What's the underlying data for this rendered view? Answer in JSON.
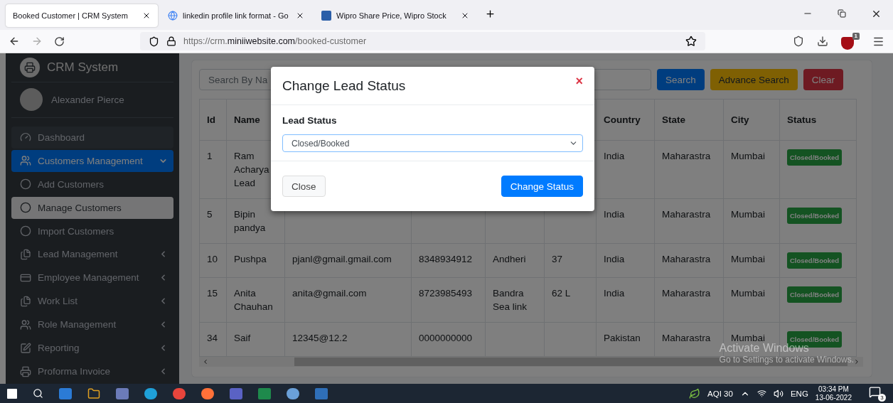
{
  "browser": {
    "tabs": [
      {
        "title": "Booked Customer | CRM System",
        "selected": true,
        "kind": "site"
      },
      {
        "title": "linkedin profile link format - Go",
        "selected": false,
        "kind": "search"
      },
      {
        "title": "Wipro Share Price, Wipro Stock",
        "selected": false,
        "kind": "stock"
      }
    ],
    "url": {
      "scheme": "https://crm.",
      "domain": "miniiwebsite.com",
      "path": "/booked-customer"
    },
    "extension_badge": "1"
  },
  "sidebar": {
    "brand": "CRM System",
    "user": "Alexander Pierce",
    "items": [
      {
        "label": "Dashboard",
        "selected": false
      },
      {
        "label": "Customers Management",
        "selected": true,
        "expanded": true,
        "children": [
          {
            "label": "Add Customers",
            "selected": false
          },
          {
            "label": "Manage Customers",
            "selected": true
          },
          {
            "label": "Import Customers",
            "selected": false
          }
        ]
      },
      {
        "label": "Lead Management",
        "selected": false,
        "expanded": false
      },
      {
        "label": "Employee Management",
        "selected": false,
        "expanded": false
      },
      {
        "label": "Work List",
        "selected": false,
        "expanded": false
      },
      {
        "label": "Role Management",
        "selected": false,
        "expanded": false
      },
      {
        "label": "Reporting",
        "selected": false,
        "expanded": false
      },
      {
        "label": "Proforma Invoice",
        "selected": false,
        "expanded": false
      }
    ]
  },
  "search": {
    "placeholder": "Search By Na"
  },
  "actions": [
    {
      "label": "Search",
      "kind": "primary"
    },
    {
      "label": "Advance Search",
      "kind": "warning"
    },
    {
      "label": "Clear",
      "kind": "danger"
    }
  ],
  "table": {
    "columns": {
      "id": "Id",
      "name": "Name",
      "country": "Country",
      "state": "State",
      "city": "City",
      "status": "Status"
    },
    "rows": [
      {
        "id": "1",
        "name": "Ram Acharya Lead",
        "country": "India",
        "state": "Maharastra",
        "city": "Mumbai",
        "status": "Closed/Booked"
      },
      {
        "id": "5",
        "name": "Bipin pandya",
        "country": "India",
        "state": "Maharastra",
        "city": "Mumbai",
        "status": "Closed/Booked"
      },
      {
        "id": "10",
        "name": "Pushpa",
        "email": "pjanl@gmail.gmail.com",
        "mobile": "8348934912",
        "column_5": "Andheri",
        "column_6": "37",
        "country": "India",
        "state": "Maharastra",
        "city": "Mumbai",
        "status": "Closed/Booked"
      },
      {
        "id": "15",
        "name": "Anita Chauhan",
        "email": "anita@gmail.com",
        "mobile": "8723985493",
        "column_5": "Bandra Sea link",
        "column_6": "62 L",
        "country": "India",
        "state": "Maharastra",
        "city": "Mumbai",
        "status": "Closed/Booked"
      },
      {
        "id": "34",
        "name": "Saif",
        "email": "12345@12.2",
        "mobile": "0000000000",
        "country": "Pakistan",
        "state": "Maharastra",
        "city": "Mumbai",
        "status": "Closed/Booked"
      }
    ]
  },
  "modal": {
    "title": "Change Lead Status",
    "close": "×",
    "field_label": "Lead Status",
    "value": "Closed/Booked",
    "buttons": [
      {
        "label": "Close",
        "kind": "secondary"
      },
      {
        "label": "Change Status",
        "kind": "primary"
      }
    ]
  },
  "os_notice": {
    "title": "Activate Windows",
    "subtitle": "Go to Settings to activate Windows."
  },
  "taskbar": {
    "aqi": "AQI 30",
    "language": "ENG",
    "time": "03:34 PM",
    "date": "13-06-2022",
    "notifications": "3"
  }
}
